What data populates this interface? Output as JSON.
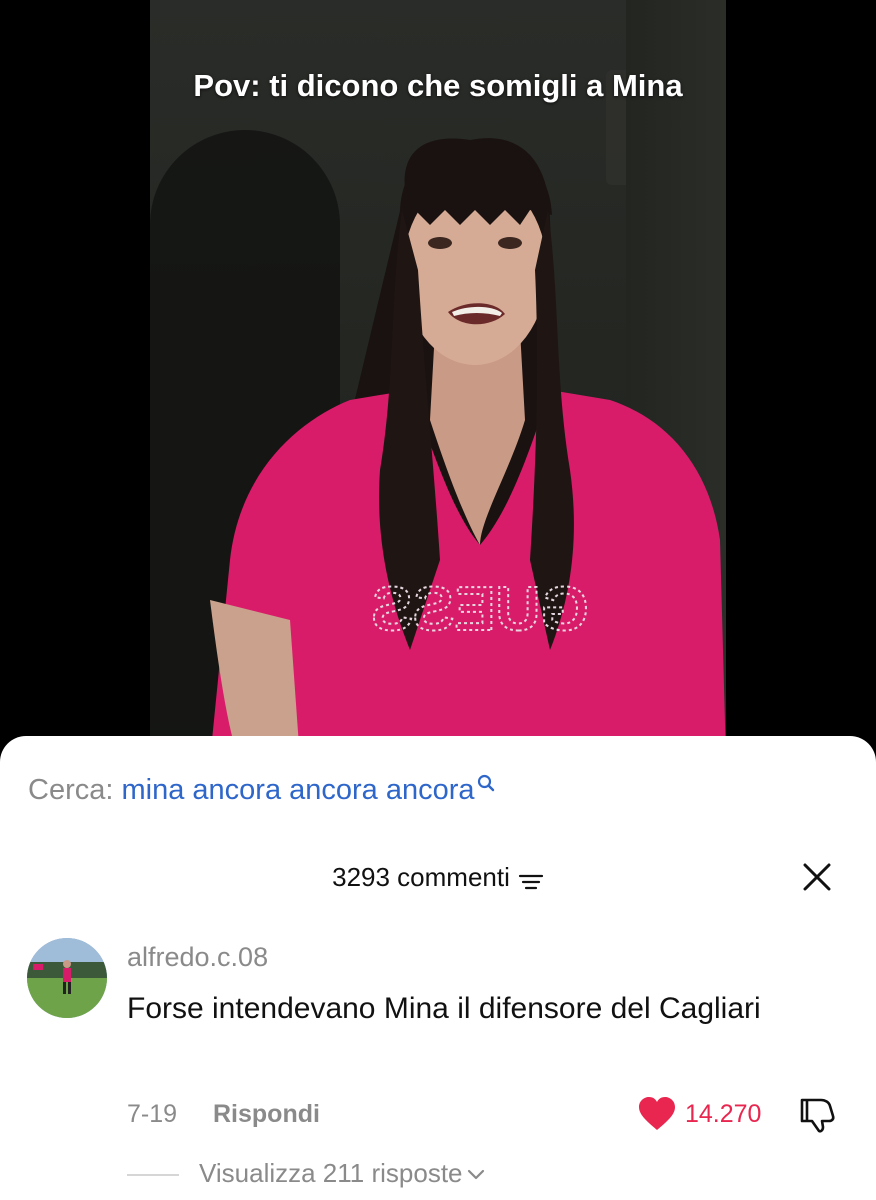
{
  "video": {
    "caption": "Pov: ti dicono che somigli a Mina",
    "shirt_text": "GUESS"
  },
  "search": {
    "prefix": "Cerca:",
    "query": "mina ancora ancora ancora",
    "icon": "search-icon"
  },
  "comments_header": {
    "count_label": "3293 commenti",
    "filter_icon": "filter-icon",
    "close_icon": "close-icon"
  },
  "comment": {
    "username": "alfredo.c.08",
    "text": "Forse intendevano Mina il difensore del Cagliari",
    "date": "7-19",
    "reply_label": "Rispondi",
    "likes": "14.270",
    "view_replies": "Visualizza 211 risposte"
  },
  "colors": {
    "accent_blue": "#2e66c9",
    "like_red": "#e8264f",
    "muted_gray": "#8a8a8a"
  }
}
